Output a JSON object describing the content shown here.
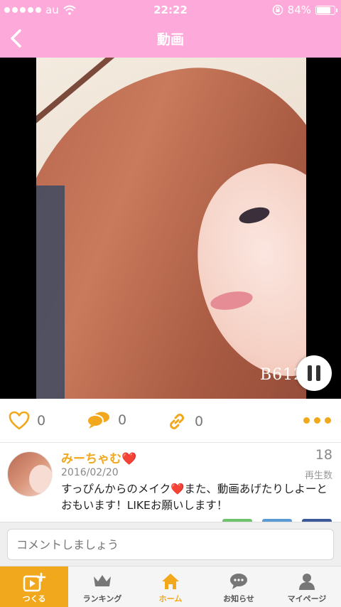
{
  "status": {
    "carrier": "au",
    "time": "22:22",
    "battery": "84%",
    "battery_level": 0.84
  },
  "nav": {
    "title": "動画"
  },
  "video": {
    "watermark": "B612",
    "state": "playing"
  },
  "actions": {
    "likes": "0",
    "comments": "0",
    "shares": "0"
  },
  "post": {
    "username": "みーちゃむ❤️",
    "date": "2016/02/20",
    "plays": "18",
    "plays_label": "再生数",
    "text": "すっぴんからのメイク❤️また、動画あげたりしよーとおもいます！LIKEお願いします！"
  },
  "comment": {
    "placeholder": "コメントしましょう"
  },
  "tabs": [
    {
      "label": "つくる"
    },
    {
      "label": "ランキング"
    },
    {
      "label": "ホーム"
    },
    {
      "label": "お知らせ"
    },
    {
      "label": "マイページ"
    }
  ],
  "colors": {
    "pink": "#fda9d9",
    "accent": "#f2a81c",
    "chip_green": "#6fc36a",
    "chip_blue": "#5b9bd5",
    "chip_navy": "#3b5998"
  }
}
